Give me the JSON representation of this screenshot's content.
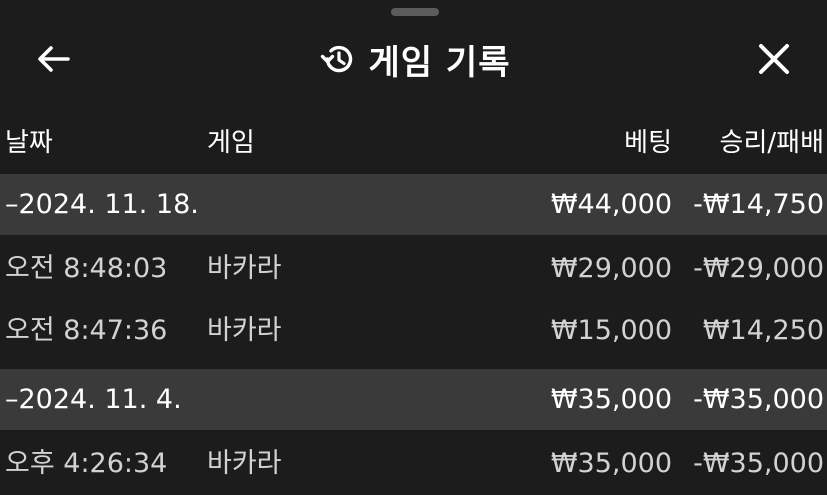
{
  "header": {
    "title": "게임 기록",
    "back_icon": "arrow-left-icon",
    "history_icon": "history-icon",
    "close_icon": "close-icon"
  },
  "columns": {
    "date": "날짜",
    "game": "게임",
    "bet": "베팅",
    "result": "승리/패배"
  },
  "groups": [
    {
      "date": "–2024. 11. 18.",
      "bet": "₩44,000",
      "result": "-₩14,750",
      "entries": [
        {
          "time": "오전 8:48:03",
          "game": "바카라",
          "bet": "₩29,000",
          "result": "-₩29,000"
        },
        {
          "time": "오전 8:47:36",
          "game": "바카라",
          "bet": "₩15,000",
          "result": "₩14,250"
        }
      ]
    },
    {
      "date": "–2024. 11. 4.",
      "bet": "₩35,000",
      "result": "-₩35,000",
      "entries": [
        {
          "time": "오후 4:26:34",
          "game": "바카라",
          "bet": "₩35,000",
          "result": "-₩35,000"
        }
      ]
    }
  ]
}
